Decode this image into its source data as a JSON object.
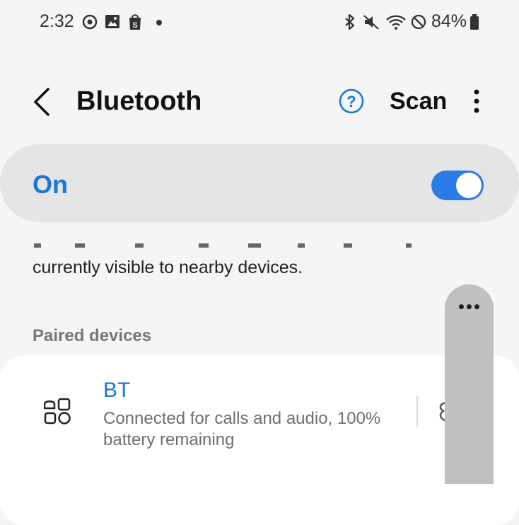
{
  "status_bar": {
    "time": "2:32",
    "battery": "84%",
    "left_icons": [
      "sync-icon",
      "image-icon",
      "shopping-bag-icon",
      "notification-dot-icon"
    ],
    "right_icons": [
      "bluetooth-icon",
      "mute-icon",
      "wifi-icon",
      "do-not-disturb-icon",
      "battery-icon"
    ]
  },
  "header": {
    "title": "Bluetooth",
    "scan_label": "Scan"
  },
  "toggle": {
    "label": "On",
    "state": true,
    "accent": "#2b7be6"
  },
  "visibility_text": "currently visible to nearby devices.",
  "paired": {
    "section_label": "Paired devices",
    "devices": [
      {
        "name": "BT",
        "status": "Connected for calls and audio, 100% battery remaining"
      }
    ]
  },
  "colors": {
    "background": "#f5f5f5",
    "card": "#ffffff",
    "toggle_card": "#e5e5e5",
    "blue": "#1976d2",
    "overlay": "#c0c0c0"
  }
}
